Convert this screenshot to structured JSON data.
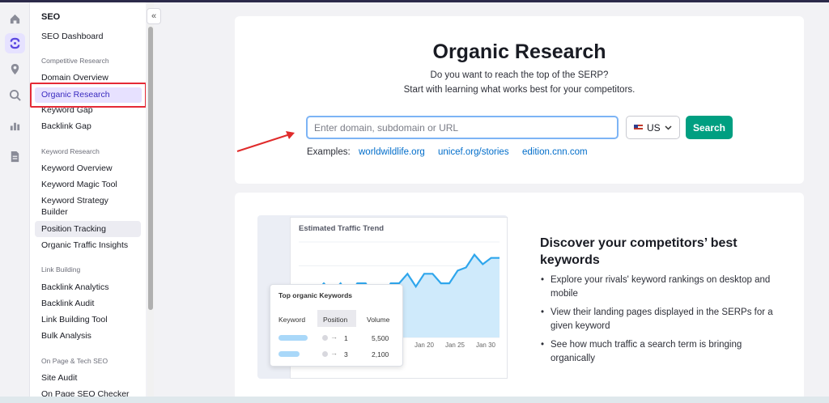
{
  "sidebar": {
    "title": "SEO",
    "collapse_icon": "«",
    "dashboard": "SEO Dashboard",
    "competitive_section": "Competitive Research",
    "competitive_items": [
      "Domain Overview",
      "Organic Research",
      "Keyword Gap",
      "Backlink Gap"
    ],
    "keyword_section": "Keyword Research",
    "keyword_items": [
      "Keyword Overview",
      "Keyword Magic Tool",
      "Keyword Strategy",
      "Builder",
      "Position Tracking",
      "Organic Traffic Insights"
    ],
    "link_section": "Link Building",
    "link_items": [
      "Backlink Analytics",
      "Backlink Audit",
      "Link Building Tool",
      "Bulk Analysis"
    ],
    "onpage_section": "On Page & Tech SEO",
    "onpage_items": [
      "Site Audit",
      "On Page SEO Checker"
    ]
  },
  "hero": {
    "title": "Organic Research",
    "subtitle_1": "Do you want to reach the top of the SERP?",
    "subtitle_2": "Start with learning what works best for your competitors.",
    "search_placeholder": "Enter domain, subdomain or URL",
    "search_value": "",
    "database": "US",
    "search_button": "Search",
    "examples_label": "Examples:",
    "examples": [
      "worldwildlife.org",
      "unicef.org/stories",
      "edition.cnn.com"
    ]
  },
  "promo": {
    "chart_title": "Estimated Traffic Trend",
    "keywords_card_title": "Top organic Keywords",
    "columns": [
      "Keyword",
      "Position",
      "Volume"
    ],
    "rows": [
      {
        "from": "",
        "position": "1",
        "volume": "5,500"
      },
      {
        "from": "",
        "position": "3",
        "volume": "2,100"
      }
    ],
    "x_labels": [
      "Jan 20",
      "Jan 25",
      "Jan 30"
    ],
    "heading": "Discover your competitors’ best keywords",
    "bullets": [
      "Explore your rivals' keyword rankings on desktop and mobile",
      "View their landing pages displayed in the SERPs for a given keyword",
      "See how much traffic a search term is bringing organically"
    ]
  },
  "chart_data": {
    "type": "area",
    "title": "Estimated Traffic Trend",
    "x": [
      "",
      "",
      "",
      "",
      "",
      "",
      "",
      "",
      "",
      "",
      "",
      "",
      "",
      "",
      "",
      "",
      "",
      "",
      "",
      "",
      "",
      "",
      "",
      "",
      ""
    ],
    "values": [
      22,
      22,
      28,
      34,
      28,
      34,
      26,
      34,
      34,
      26,
      26,
      34,
      34,
      40,
      32,
      40,
      40,
      34,
      34,
      42,
      44,
      52,
      46,
      50,
      50
    ],
    "x_tick_labels": [
      "Jan 20",
      "Jan 25",
      "Jan 30"
    ],
    "ylim": [
      0,
      60
    ],
    "grid": true
  },
  "colors": {
    "accent": "#009f81",
    "link": "#006dca",
    "active_nav": "#e7e1ff",
    "highlight_box": "#e52a36",
    "chart_line": "#2fa6ec",
    "chart_fill": "#cfeafb"
  }
}
